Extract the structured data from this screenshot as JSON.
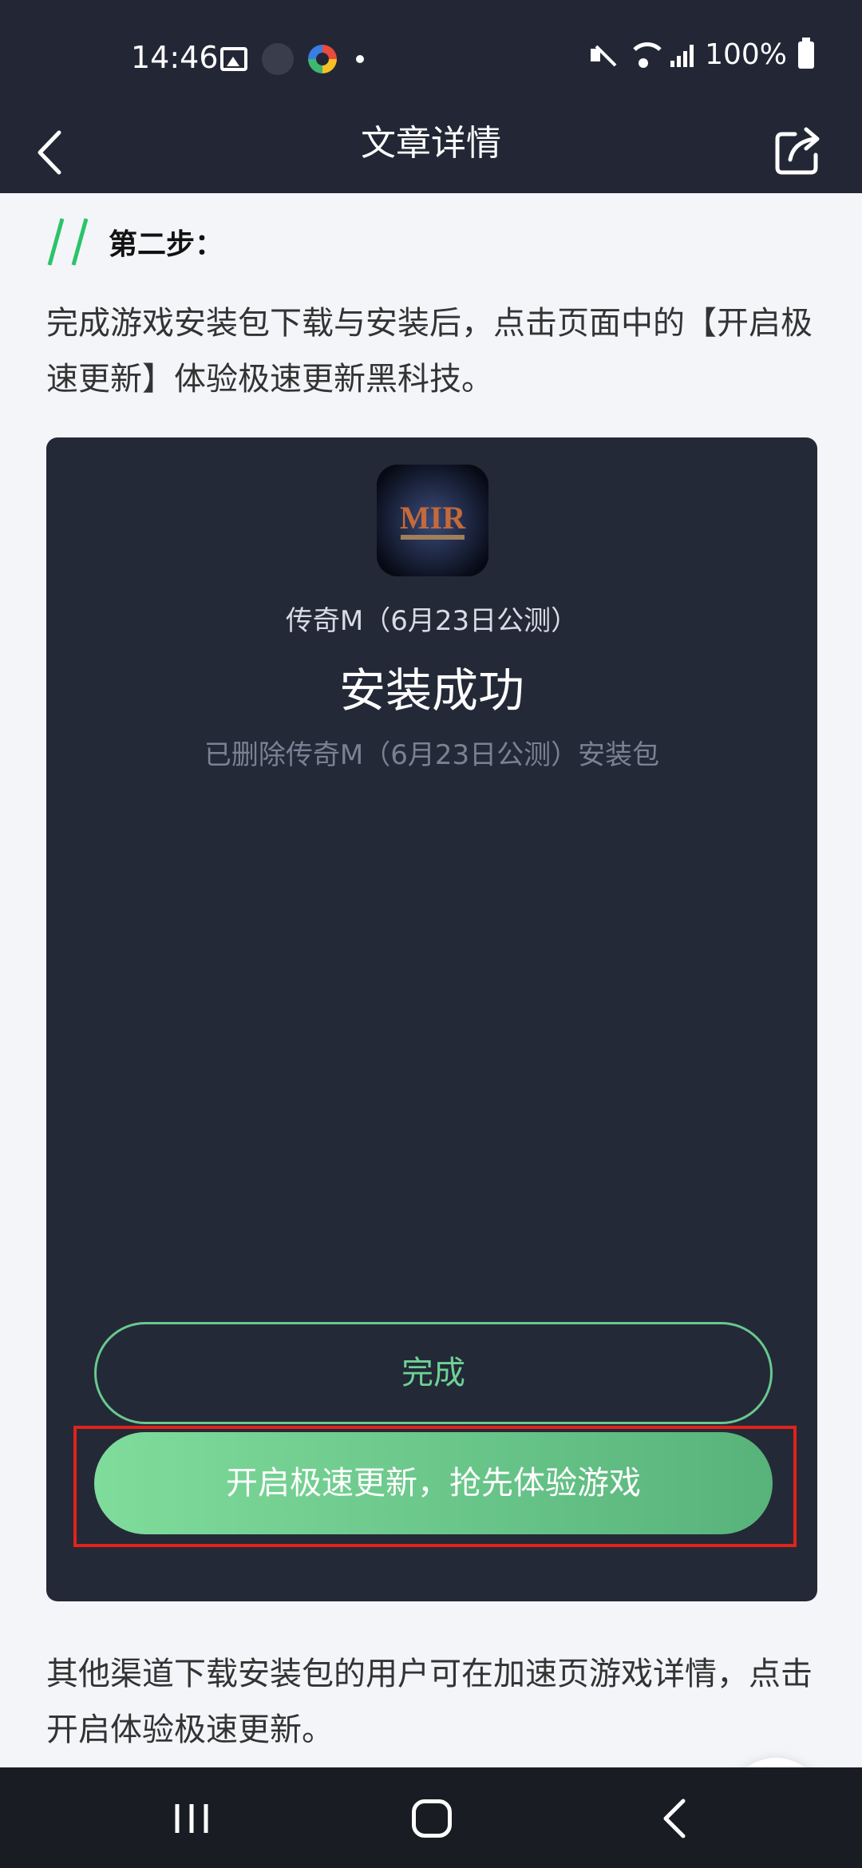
{
  "status_bar": {
    "time": "14:46",
    "battery": "100%"
  },
  "header": {
    "title": "文章详情"
  },
  "article": {
    "step_title": "第二步：",
    "paragraph1": "完成游戏安装包下载与安装后，点击页面中的【开启极速更新】体验极速更新黑科技。",
    "paragraph2": "其他渠道下载安装包的用户可在加速页游戏详情，点击开启体验极速更新。"
  },
  "screenshot": {
    "game_name": "传奇M（6月23日公测）",
    "install_title": "安装成功",
    "install_sub": "已删除传奇M（6月23日公测）安装包",
    "done_label": "完成",
    "boost_label": "开启极速更新，抢先体验游戏",
    "game_logo_text": "MIR"
  },
  "colors": {
    "accent_green": "#57b37a",
    "header_bg": "#232735",
    "highlight_red": "#e0231b",
    "like_orange": "#f7a21b"
  }
}
